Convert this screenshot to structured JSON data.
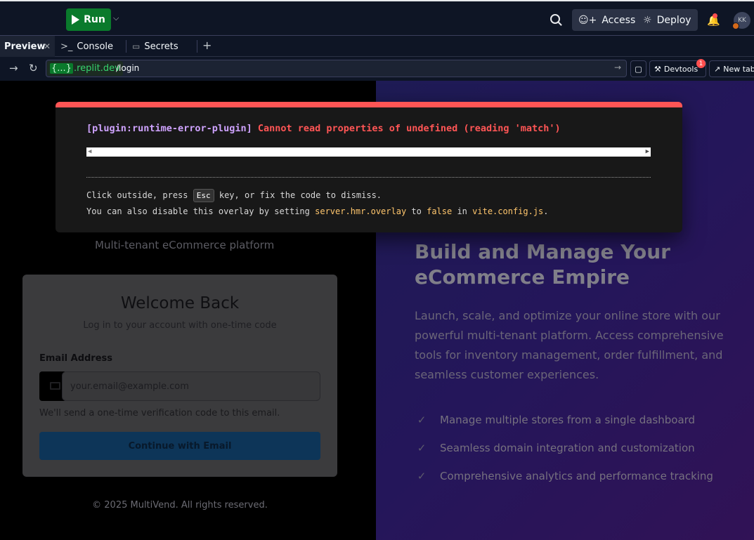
{
  "topbar": {
    "run_label": "Run",
    "access_label": "Access",
    "deploy_label": "Deploy",
    "avatar_initials": "KK"
  },
  "tabs": [
    {
      "label": "Preview",
      "active": true
    },
    {
      "label": "Console",
      "icon": ">_"
    },
    {
      "label": "Secrets",
      "icon": "lock"
    }
  ],
  "urlbar": {
    "domain_brace": "{...}",
    "domain": ".replit.dev",
    "path": "/login",
    "devtools_label": "Devtools",
    "devtools_badge": "1",
    "newtab_label": "New tab"
  },
  "error_overlay": {
    "plugin": "[plugin:runtime-error-plugin]",
    "message": "Cannot read properties of undefined (reading 'match')",
    "tip1_pre": "Click outside, press",
    "tip1_key": "Esc",
    "tip1_post": "key, or fix the code to dismiss.",
    "tip2_a": "You can also disable this overlay by setting",
    "tip2_code1": "server.hmr.overlay",
    "tip2_b": "to",
    "tip2_code2": "false",
    "tip2_c": "in",
    "tip2_code3": "vite.config.js",
    "tip2_d": "."
  },
  "login": {
    "tagline": "Multi-tenant eCommerce platform",
    "title": "Welcome Back",
    "subtitle": "Log in to your account with one-time code",
    "email_label": "Email Address",
    "email_placeholder": "your.email@example.com",
    "hint": "We'll send a one-time verification code to this email.",
    "submit_label": "Continue with Email",
    "footer": "© 2025 MultiVend. All rights reserved."
  },
  "hero": {
    "title": "Build and Manage Your eCommerce Empire",
    "body": "Launch, scale, and optimize your online store with our powerful multi-tenant platform. Access comprehensive tools for inventory management, order fulfillment, and seamless customer experiences.",
    "features": [
      "Manage multiple stores from a single dashboard",
      "Seamless domain integration and customization",
      "Comprehensive analytics and performance tracking"
    ]
  }
}
